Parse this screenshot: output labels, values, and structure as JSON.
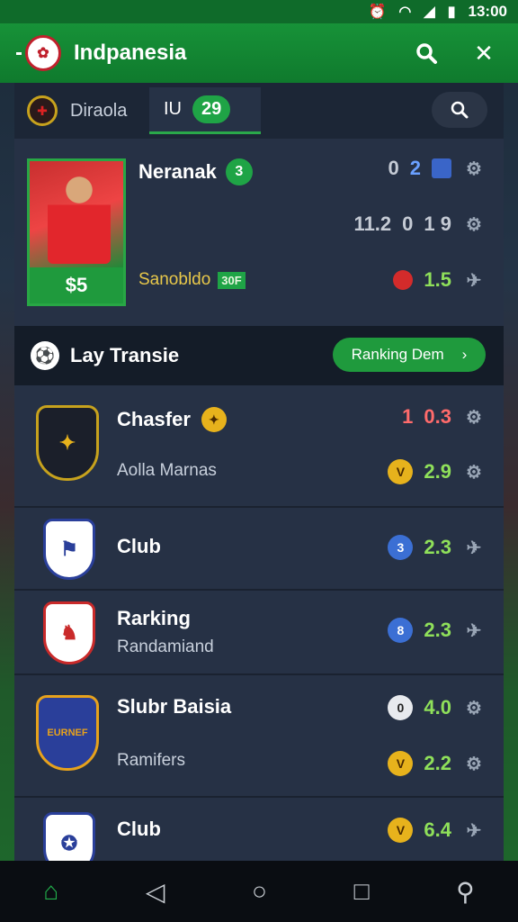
{
  "status": {
    "time": "13:00",
    "icons": [
      "alarm-icon",
      "wifi-icon",
      "signal-icon",
      "battery-icon"
    ]
  },
  "appbar": {
    "title": "Indpanesia",
    "search_icon": "search-icon",
    "close_icon": "close-icon"
  },
  "tabs": {
    "tab_a": "Diraola",
    "tab_b_label": "IU",
    "tab_b_badge": "29"
  },
  "hero": {
    "name": "Neranak",
    "name_badge": "3",
    "sub": "Sanobldo",
    "sub_tag": "30F",
    "price": "$5",
    "stats": [
      {
        "left": "0",
        "right": "2"
      },
      {
        "left": "11.2",
        "mid": "0",
        "right": "1 9"
      },
      {
        "value": "1.5"
      }
    ]
  },
  "section": {
    "title": "Lay Transie",
    "cta": "Ranking Dem",
    "cta_chevron": "›"
  },
  "rows": [
    {
      "title": "Chasfer",
      "subtitle": "Aolla Marnas",
      "stat1_left": "1",
      "stat1_value": "0.3",
      "stat2_value": "2.9",
      "crest_text": "✦"
    },
    {
      "title": "Club",
      "stat2_coin": "3",
      "stat2_value": "2.3",
      "crest_text": "⚑"
    },
    {
      "title": "Rarking",
      "subtitle": "Randamiand",
      "stat2_coin": "8",
      "stat2_value": "2.3",
      "crest_text": "♞"
    },
    {
      "title": "Slubr Baisia",
      "subtitle": "Ramifers",
      "stat1_coin": "0",
      "stat1_value": "4.0",
      "stat2_value": "2.2",
      "crest_text": "EURNEF"
    },
    {
      "title": "Club",
      "stat2_value": "6.4",
      "crest_text": "✪"
    }
  ],
  "colors": {
    "accent": "#1f9a3d",
    "panel": "#263145",
    "value_green": "#8fe05a",
    "value_red": "#ff6b6b"
  }
}
